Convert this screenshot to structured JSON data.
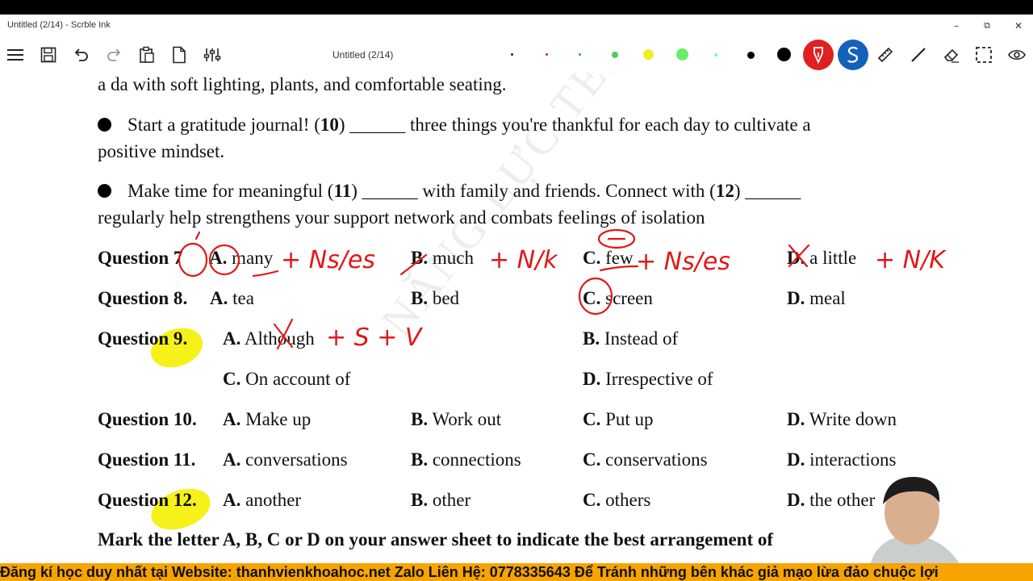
{
  "window": {
    "title": "Untitled (2/14) - Scrble Ink",
    "minimize_glyph": "–",
    "restore_glyph": "⧉",
    "close_glyph": "✕"
  },
  "toolbar": {
    "doc_title": "Untitled (2/14)",
    "icons": [
      "menu-icon",
      "save-icon",
      "undo-icon",
      "redo-icon",
      "paste-icon",
      "page-icon",
      "settings-sliders-icon"
    ],
    "pen_colors": [
      "#222222",
      "#d22",
      "#1a8",
      "#5c5",
      "#ee2",
      "#6e6",
      "#8ec",
      "#000000",
      "#000000"
    ],
    "active_pen_color": "#e02020",
    "pen2_color": "#1560b8"
  },
  "doc": {
    "line_intro": "a da with soft lighting, plants, and comfortable seating.",
    "b1_start": "Start a gratitude journal! (",
    "b1_num": "10",
    "b1_end": ") ______ three things you're thankful for each day to cultivate a",
    "b1_line2": "positive mindset.",
    "b2_start": "Make time for meaningful (",
    "b2_num1": "11",
    "b2_mid": ") ______ with family and friends. Connect with (",
    "b2_num2": "12",
    "b2_end": ") ______",
    "b2_line2": "regularly help strengthens your support network and combats feelings of isolation",
    "questions": [
      {
        "label": "Question 7",
        "A": "many",
        "B": "much",
        "C": "few",
        "D": "a little"
      },
      {
        "label": "Question 8",
        "A": "tea",
        "B": "bed",
        "C": "screen",
        "D": "meal"
      },
      {
        "label": "Question 9",
        "A": "Although",
        "B": "Instead of",
        "C": "On account of",
        "D": "Irrespective of"
      },
      {
        "label": "Question 10",
        "A": "Make up",
        "B": "Work out",
        "C": "Put up",
        "D": "Write down"
      },
      {
        "label": "Question 11",
        "A": "conversations",
        "B": "connections",
        "C": "conservations",
        "D": "interactions"
      },
      {
        "label": "Question 12",
        "A": "another",
        "B": "other",
        "C": "others",
        "D": "the other"
      }
    ],
    "letters": {
      "A": "A.",
      "B": "B.",
      "C": "C.",
      "D": "D."
    },
    "q7_A_letter": "A.",
    "q7_D_letter": "D.",
    "bottom_line": "Mark the letter A, B, C or D on your answer sheet to indicate the best arrangement of"
  },
  "annotations": {
    "q7_A": "+ Ns/es",
    "q7_B": "+ N/k",
    "q7_C": "+ Ns/es",
    "q7_D": "+ N/K",
    "q9_A": "+ S + V"
  },
  "watermark": "NĂNG LỰC TEAM EMPIRE",
  "banner": "Đăng kí học duy nhất tại Website: thanhvienkhoahoc.net  Zalo Liên Hệ: 0778335643 Để Tránh những bên khác giả mạo lừa đảo chuộc lợi"
}
